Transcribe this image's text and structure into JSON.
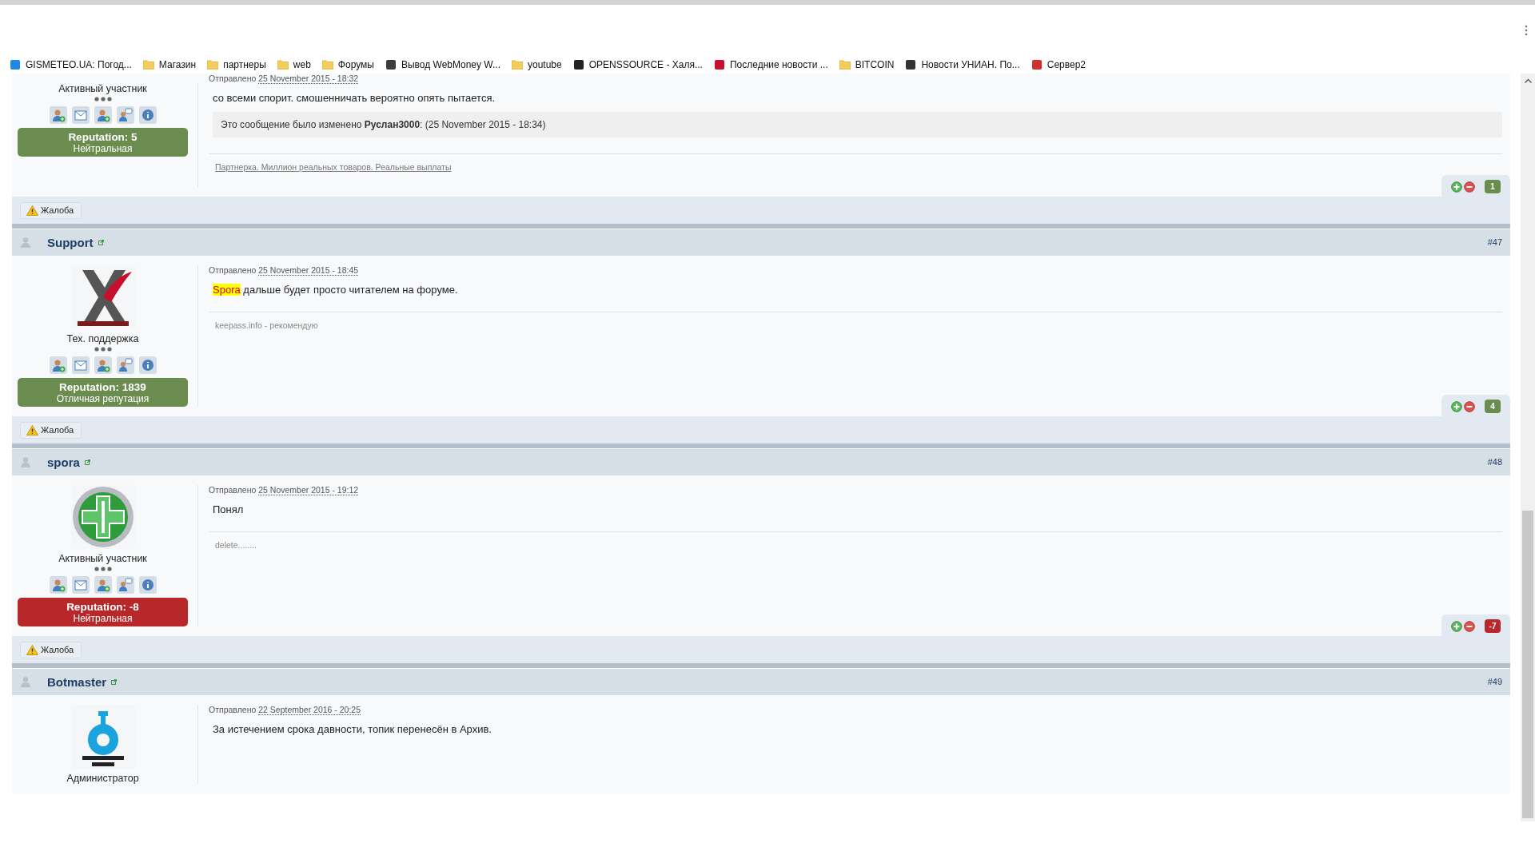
{
  "bookmarks": [
    {
      "label": "GISMETEO.UA: Погод...",
      "kind": "site",
      "color": "#1e88e5"
    },
    {
      "label": "Магазин",
      "kind": "folder"
    },
    {
      "label": "партнеры",
      "kind": "folder"
    },
    {
      "label": "web",
      "kind": "folder"
    },
    {
      "label": "Форумы",
      "kind": "folder"
    },
    {
      "label": "Вывод WebMoney W...",
      "kind": "site",
      "color": "#3b3b3b"
    },
    {
      "label": "youtube",
      "kind": "folder"
    },
    {
      "label": "OPENSSOURCE - Халя...",
      "kind": "site",
      "color": "#222222"
    },
    {
      "label": "Последние новости ...",
      "kind": "site",
      "color": "#c8102e"
    },
    {
      "label": "BITCOIN",
      "kind": "folder"
    },
    {
      "label": "Новости УНИАН. По...",
      "kind": "site",
      "color": "#333333"
    },
    {
      "label": "Сервер2",
      "kind": "site",
      "color": "#d32f2f"
    }
  ],
  "posts": [
    {
      "role": "Активный участник",
      "rank_dots": true,
      "action_icons": true,
      "reputation": {
        "title": "Reputation: 5",
        "text": "Нейтральная",
        "color": "#6b8c4f"
      },
      "posted_label": "Отправлено",
      "date": "25 November 2015 - 18:32",
      "message": [
        {
          "text": "со всеми спорит. смошенничать вероятно опять пытается.",
          "highlighted": false
        }
      ],
      "edit_note": "Это сообщение было изменено **Руслан3000**: (25 November 2015 - 18:34)",
      "signature": {
        "text": "Партнерка. Миллион реальных товаров. Реальные выплаты",
        "link": true
      },
      "votes": {
        "count": "1",
        "color": "#6b8c4f"
      },
      "report": "Жалоба"
    },
    {
      "author": "Support",
      "number": "#47",
      "avatar": {
        "kind": "picture"
      },
      "role": "Тех. поддержка",
      "rank_dots": true,
      "action_icons": true,
      "reputation": {
        "title": "Reputation: 1839",
        "text": "Отличная репутация",
        "color": "#6b8c4f"
      },
      "posted_label": "Отправлено",
      "date": "25 November 2015 - 18:45",
      "message": [
        {
          "text": "Spora",
          "highlighted": true
        },
        {
          "text": " дальше будет просто читателем на форуме.",
          "highlighted": false
        }
      ],
      "signature": {
        "text": "keepass.info - рекомендую",
        "link": false
      },
      "votes": {
        "count": "4",
        "color": "#6b8c4f"
      },
      "report": "Жалоба"
    },
    {
      "author": "spora",
      "number": "#48",
      "avatar": {
        "kind": "picture"
      },
      "role": "Активный участник",
      "rank_dots": true,
      "action_icons": true,
      "reputation": {
        "title": "Reputation: -8",
        "text": "Нейтральная",
        "color": "#b8282b"
      },
      "posted_label": "Отправлено",
      "date": "25 November 2015 - 19:12",
      "message": [
        {
          "text": "Понял",
          "highlighted": false
        }
      ],
      "signature": {
        "text": "delete........",
        "link": false
      },
      "votes": {
        "count": "-7",
        "color": "#b8282b"
      },
      "report": "Жалоба"
    },
    {
      "author": "Botmaster",
      "number": "#49",
      "avatar": {
        "kind": "picture"
      },
      "role": "Администратор",
      "rank_dots": false,
      "action_icons": false,
      "posted_label": "Отправлено",
      "date": "22 September 2016 - 20:25",
      "message": [
        {
          "text": "За истечением срока давности, топик перенесён в Архив.",
          "highlighted": false
        }
      ]
    }
  ]
}
